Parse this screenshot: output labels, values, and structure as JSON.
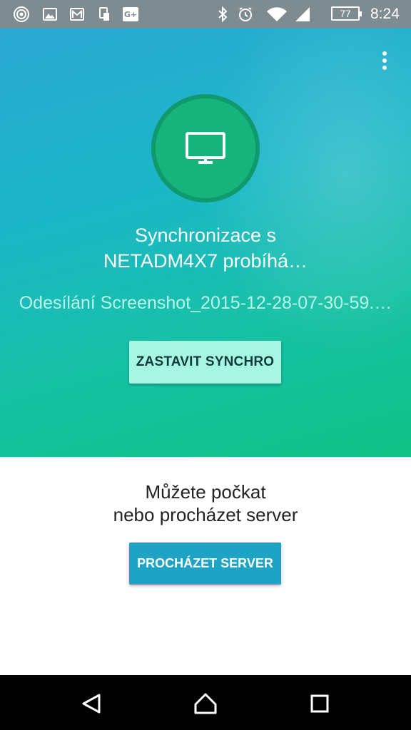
{
  "status_bar": {
    "battery": "77",
    "time": "8:24",
    "icons": [
      "target-icon",
      "image-icon",
      "gmail-icon",
      "device-icon",
      "google-plus-icon",
      "bluetooth-icon",
      "alarm-icon",
      "wifi-icon",
      "signal-icon"
    ]
  },
  "hero": {
    "title_line1": "Synchronizace s",
    "title_line2": "NETADM4X7 probíhá…",
    "file_status": "Odesílání Screenshot_2015-12-28-07-30-59.…",
    "stop_button": "ZASTAVIT SYNCHRO",
    "icon": "monitor-icon"
  },
  "lower": {
    "line1": "Můžete počkat",
    "line2": "nebo procházet server",
    "browse_button": "PROCHÁZET SERVER"
  },
  "navigation": {
    "icons": [
      "back-icon",
      "home-icon",
      "recents-icon"
    ]
  },
  "colors": {
    "status_bar": "#7e8c92",
    "gradient_top": "#2aa8d2",
    "gradient_bottom": "#0fc184",
    "circle_ring": "#0e9a6c",
    "circle_fill": "#16b47b",
    "stop_button": "#a7f6e4",
    "browse_button": "#1fa3c4"
  }
}
